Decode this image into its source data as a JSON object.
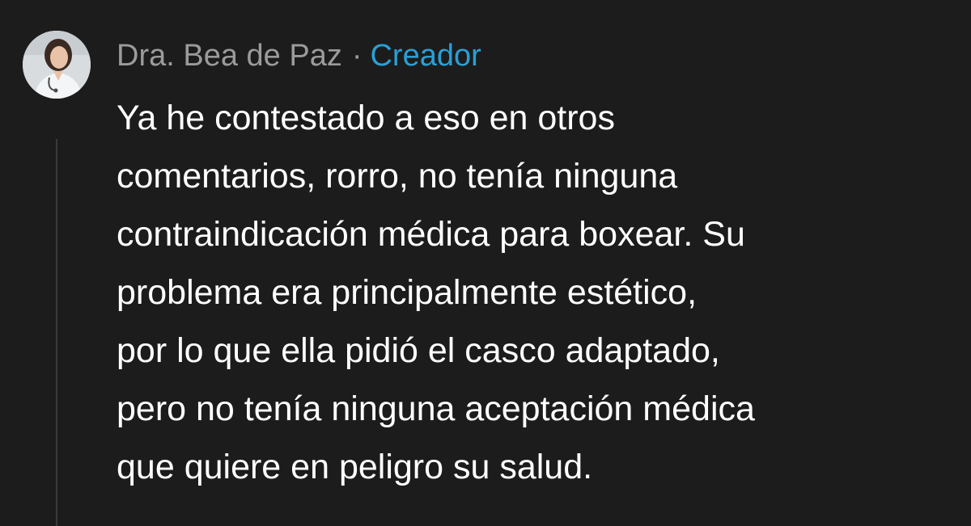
{
  "comment": {
    "author": "Dra. Bea de Paz",
    "separator": "·",
    "badge": "Creador",
    "avatar_icon": "profile-photo",
    "body_lines": [
      "Ya he contestado a eso en otros",
      "comentarios, rorro, no tenía ninguna",
      "contraindicación médica para boxear. Su",
      "problema era principalmente estético,",
      "por lo que ella pidió el casco adaptado,",
      "pero no tenía ninguna aceptación médica",
      "que quiere en peligro su salud."
    ]
  },
  "colors": {
    "background": "#1c1c1c",
    "author": "#9b9b9b",
    "badge": "#2a9fd6",
    "body": "#ffffff",
    "thread_line": "#3a3a3a"
  }
}
